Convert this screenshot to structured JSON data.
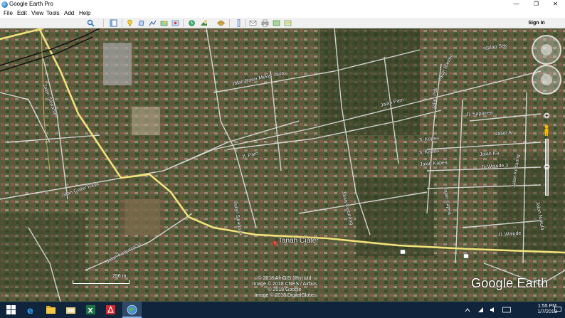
{
  "window": {
    "title": "Google Earth Pro",
    "minimize": "—",
    "restore": "❐",
    "close": "✕"
  },
  "menu": [
    "File",
    "Edit",
    "View",
    "Tools",
    "Add",
    "Help"
  ],
  "toolbar": {
    "signin_label": "Sign in",
    "icons": [
      "search-icon",
      "sidebar-icon",
      "placemark-icon",
      "polygon-icon",
      "path-icon",
      "overlay-icon",
      "tour-icon",
      "historical-imagery-icon",
      "sun-icon",
      "planets-icon",
      "ruler-icon",
      "email-icon",
      "print-icon",
      "save-image-icon",
      "view-in-maps-icon"
    ]
  },
  "map": {
    "place_label": "Tanah Ciater",
    "road_labels": [
      "Jalan Siliwangi",
      "Jalan Rawa Mekar Jaya",
      "Jalan Pam",
      "Jl. Pam",
      "Jalan Ciater Raya",
      "Jalan Kencana Vi",
      "Jalan Swadaya",
      "Jalan Ceiturang",
      "Jalan Sek",
      "Jalan Bambu",
      "Jalan Poli",
      "Jl. Sapatrea",
      "Jalan Ar",
      "Jl. Kapea",
      "Jl. Kapea",
      "Jalan Ka",
      "Jalan Kapea",
      "Jl. Walude 3",
      "Jalan Kapea",
      "Jalan Kedaung",
      "Jalan Nakula",
      "Jl. Walude"
    ],
    "credits": [
      "© 2018 AfriGIS (Pty) Ltd",
      "Image © 2018 CNES / Airbus",
      "© 2018 Google",
      "Image © 2018 DigitalGlobe"
    ],
    "scale_text": "256 m",
    "logo": "Google Earth"
  },
  "taskbar": {
    "icons": [
      "windows-start-icon",
      "edge-icon",
      "file-explorer-icon",
      "folder-icon",
      "excel-icon",
      "acrobat-icon",
      "google-earth-icon"
    ],
    "time": "1:55 PM",
    "date": "1/7/2019"
  },
  "colors": {
    "road_major": "#f2e27a",
    "road_minor": "#e8e8e8",
    "imagery_base": "#4a5434",
    "taskbar": "#10243c"
  }
}
